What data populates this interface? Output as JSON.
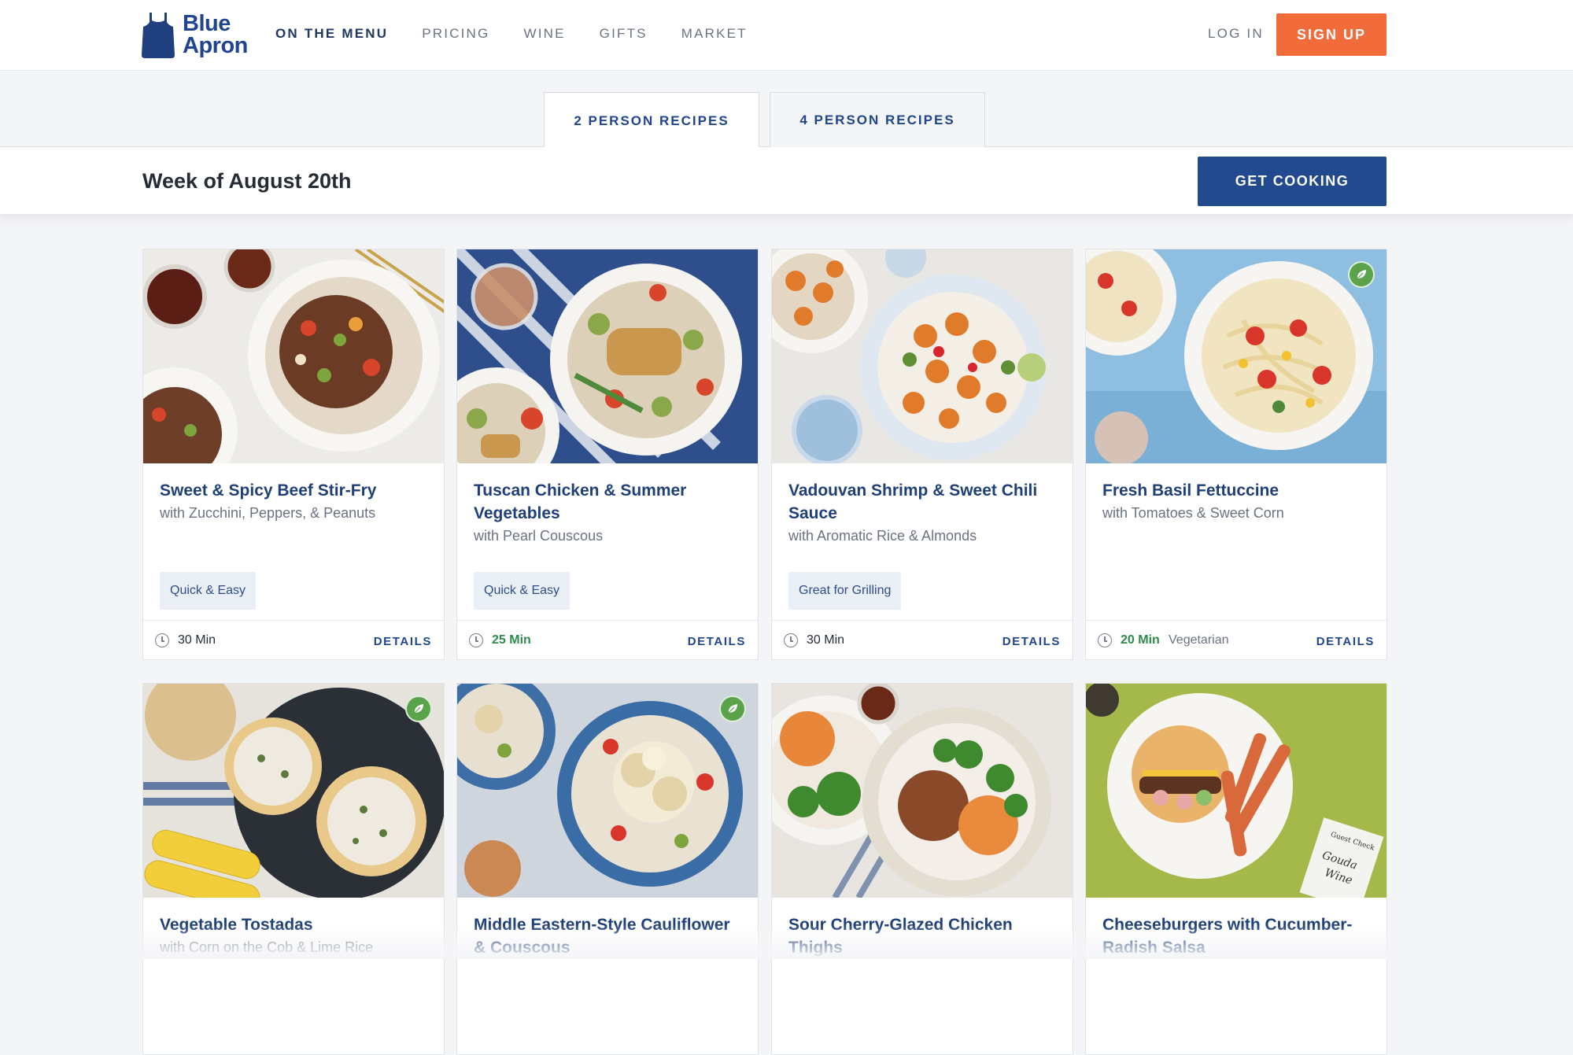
{
  "brand": {
    "line1": "Blue",
    "line2": "Apron"
  },
  "nav": {
    "items": [
      "ON THE MENU",
      "PRICING",
      "WINE",
      "GIFTS",
      "MARKET"
    ],
    "login": "LOG IN",
    "signup": "SIGN UP"
  },
  "tabs": [
    "2 PERSON RECIPES",
    "4 PERSON RECIPES"
  ],
  "week": {
    "title": "Week of August 20th",
    "cta": "GET COOKING"
  },
  "cards": [
    {
      "title": "Sweet & Spicy Beef Stir-Fry",
      "subtitle": "with Zucchini, Peppers, & Peanuts",
      "tag": "Quick & Easy",
      "time": "30 Min",
      "diet": "",
      "details": "DETAILS"
    },
    {
      "title": "Tuscan Chicken & Summer Vegetables",
      "subtitle": "with Pearl Couscous",
      "tag": "Quick & Easy",
      "time": "25 Min",
      "diet": "",
      "details": "DETAILS"
    },
    {
      "title": "Vadouvan Shrimp & Sweet Chili Sauce",
      "subtitle": "with Aromatic Rice & Almonds",
      "tag": "Great for Grilling",
      "time": "30 Min",
      "diet": "",
      "details": "DETAILS"
    },
    {
      "title": "Fresh Basil Fettuccine",
      "subtitle": "with Tomatoes & Sweet Corn",
      "tag": "",
      "time": "20 Min",
      "diet": "Vegetarian",
      "details": "DETAILS"
    },
    {
      "title": "Vegetable Tostadas",
      "subtitle": "with Corn on the Cob & Lime Rice"
    },
    {
      "title": "Middle Eastern-Style Cauliflower & Couscous",
      "subtitle": ""
    },
    {
      "title": "Sour Cherry-Glazed Chicken Thighs",
      "subtitle": ""
    },
    {
      "title": "Cheeseburgers with Cucumber-Radish Salsa",
      "subtitle": ""
    }
  ],
  "image_note_text": {
    "line1": "Guest Check",
    "line2": "Gouda",
    "line3": "Wine"
  }
}
